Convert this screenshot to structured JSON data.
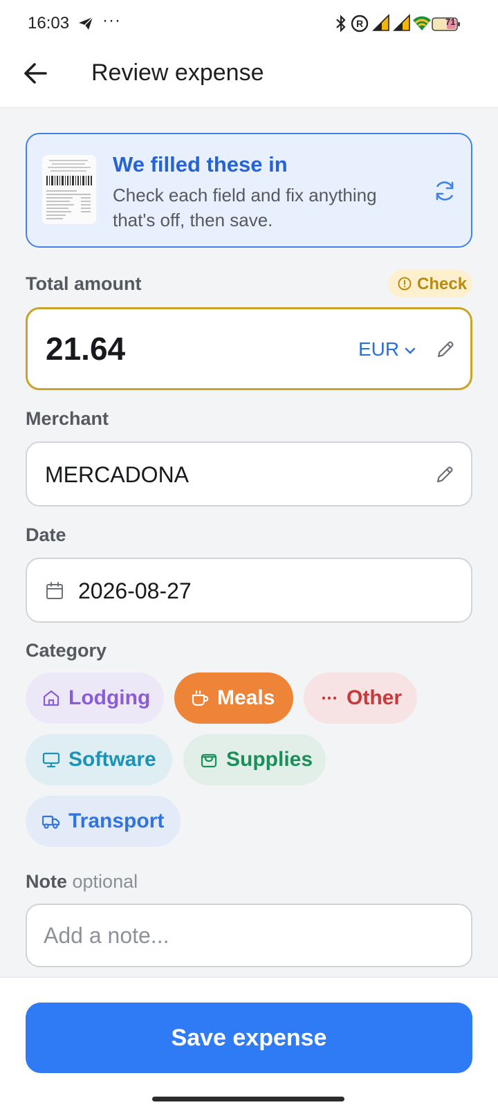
{
  "status_bar": {
    "time": "16:03",
    "overflow": "···",
    "battery": "71",
    "icons": [
      "telegram-icon",
      "bluetooth-icon",
      "registered-icon",
      "signal-icon",
      "signal-icon",
      "wifi-icon",
      "battery-icon"
    ]
  },
  "app_bar": {
    "title": "Review expense",
    "back_icon": "arrow-left-icon"
  },
  "info_card": {
    "title": "We filled these in",
    "text": "Check each field and fix anything that's off, then save.",
    "refresh_icon": "refresh-icon",
    "accent": "#3f82e8"
  },
  "amount": {
    "label": "Total amount",
    "badge": "Check",
    "value": "21.64",
    "currency": "EUR",
    "warn_color": "#c9a227"
  },
  "merchant": {
    "label": "Merchant",
    "value": "MERCADONA"
  },
  "date": {
    "label": "Date",
    "value": "2026-08-27"
  },
  "category": {
    "label": "Category",
    "selected": "Meals",
    "chips": [
      {
        "label": "Lodging",
        "icon": "home-icon",
        "bg": "#ede8f8",
        "color": "#8a5cd6"
      },
      {
        "label": "Meals",
        "icon": "coffee-cup-icon",
        "bg": "#ee8437",
        "color": "#ffffff"
      },
      {
        "label": "Other",
        "icon": "more-dots-icon",
        "bg": "#f7e3e4",
        "color": "#c73a3a"
      },
      {
        "label": "Software",
        "icon": "monitor-icon",
        "bg": "#dfeef3",
        "color": "#1b93b5"
      },
      {
        "label": "Supplies",
        "icon": "shopping-bag-icon",
        "bg": "#e1efe8",
        "color": "#1b8f5a"
      },
      {
        "label": "Transport",
        "icon": "truck-icon",
        "bg": "#e3ebf8",
        "color": "#2f74e0"
      }
    ]
  },
  "note": {
    "label": "Note",
    "optional": "optional",
    "placeholder": "Add a note..."
  },
  "footer": {
    "save_label": "Save expense",
    "button_color": "#2f7bf5"
  }
}
